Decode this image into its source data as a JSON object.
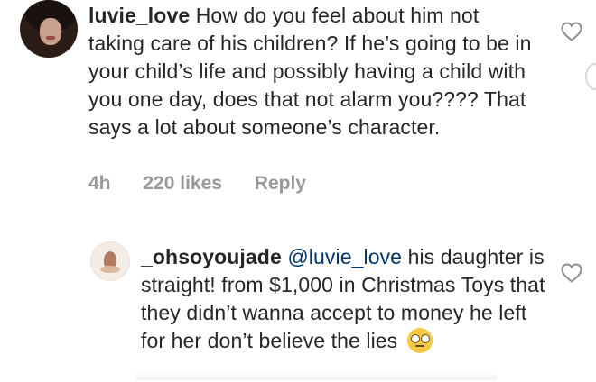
{
  "comment": {
    "username": "luvie_love",
    "text": " How do you feel about him not taking care of his children? If he’s going to be in your child’s life and possibly having a child with you one day, does that not alarm you???? That says a lot about someone’s character.",
    "time": "4h",
    "likes": "220 likes",
    "reply_label": "Reply",
    "avatar_icon": "profile-photo-woman",
    "heart_icon": "heart-outline"
  },
  "reply": {
    "username": "_ohsoyoujade",
    "mention": "@luvie_love",
    "text": " his daughter is straight! from $1,000 in Christmas Toys that they didn’t wanna accept to money he left for her don’t believe the lies",
    "emoji_icon": "face-with-rolling-eyes-emoji",
    "avatar_icon": "profile-photo-small",
    "heart_icon": "heart-outline"
  },
  "colors": {
    "text": "#262626",
    "meta": "#999999",
    "mention": "#003569"
  }
}
